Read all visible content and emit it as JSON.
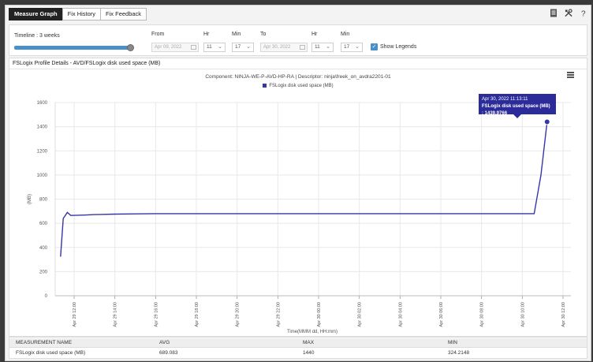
{
  "tabs": [
    {
      "label": "Measure Graph",
      "active": true
    },
    {
      "label": "Fix History",
      "active": false
    },
    {
      "label": "Fix Feedback",
      "active": false
    }
  ],
  "top_icons": [
    "document-icon",
    "tools-icon",
    "help-icon"
  ],
  "controls": {
    "timeline_label": "Timeline : 3 weeks",
    "slider_fraction": 0.97,
    "from_label": "From",
    "from_date": "Apr 09, 2022",
    "from_hr_label": "Hr",
    "from_hr": "11",
    "from_min_label": "Min",
    "from_min": "17",
    "to_label": "To",
    "to_date": "Apr 30, 2022",
    "to_hr_label": "Hr",
    "to_hr": "11",
    "to_min_label": "Min",
    "to_min": "17",
    "show_legends_label": "Show Legends",
    "show_legends_checked": true
  },
  "panel": {
    "title": "FSLogix Profile Details - AVD/FSLogix disk used space (MB)",
    "subtitle": "Component: NINJA-WE-P-AVD-HP-RA | Descriptor: ninja\\freek_on_avdra2201-01",
    "legend_label": "FSLogix disk used space (MB)"
  },
  "tooltip": {
    "time": "Apr 30, 2022 11:13:11",
    "text": "FSLogix disk used space (MB) : 1439.9766"
  },
  "chart_data": {
    "type": "line",
    "ylabel": "(MB)",
    "xlabel": "Time(MMM dd, HH:mm)",
    "ylim": [
      0,
      1600
    ],
    "y_ticks": [
      0,
      200,
      400,
      600,
      800,
      1000,
      1200,
      1400,
      1600
    ],
    "x_ticks": [
      "Apr 29 12:00",
      "Apr 29 14:00",
      "Apr 29 16:00",
      "Apr 29 18:00",
      "Apr 29 20:00",
      "Apr 29 22:00",
      "Apr 30 00:00",
      "Apr 30 02:00",
      "Apr 30 04:00",
      "Apr 30 06:00",
      "Apr 30 08:00",
      "Apr 30 10:00",
      "Apr 30 12:00"
    ],
    "grid": true,
    "legend_position": "top-center",
    "series": [
      {
        "name": "FSLogix disk used space (MB)",
        "color": "#3636a8",
        "points": [
          [
            "Apr 29 11:20",
            324.2
          ],
          [
            "Apr 29 11:28",
            640
          ],
          [
            "Apr 29 11:40",
            690
          ],
          [
            "Apr 29 11:50",
            665
          ],
          [
            "Apr 29 12:30",
            668
          ],
          [
            "Apr 29 13:00",
            672
          ],
          [
            "Apr 29 14:00",
            676
          ],
          [
            "Apr 29 15:00",
            678
          ],
          [
            "Apr 29 16:00",
            680
          ],
          [
            "Apr 30 10:00",
            680
          ],
          [
            "Apr 30 10:35",
            680
          ],
          [
            "Apr 30 10:55",
            1000
          ],
          [
            "Apr 30 11:13",
            1439.9766
          ]
        ]
      }
    ],
    "highlight_point": [
      "Apr 30 11:13",
      1439.9766
    ]
  },
  "stats": {
    "headers": [
      "MEASUREMENT NAME",
      "AVG",
      "MAX",
      "MIN"
    ],
    "row": [
      "FSLogix disk used space (MB)",
      "689.083",
      "1440",
      "324.2148"
    ]
  }
}
